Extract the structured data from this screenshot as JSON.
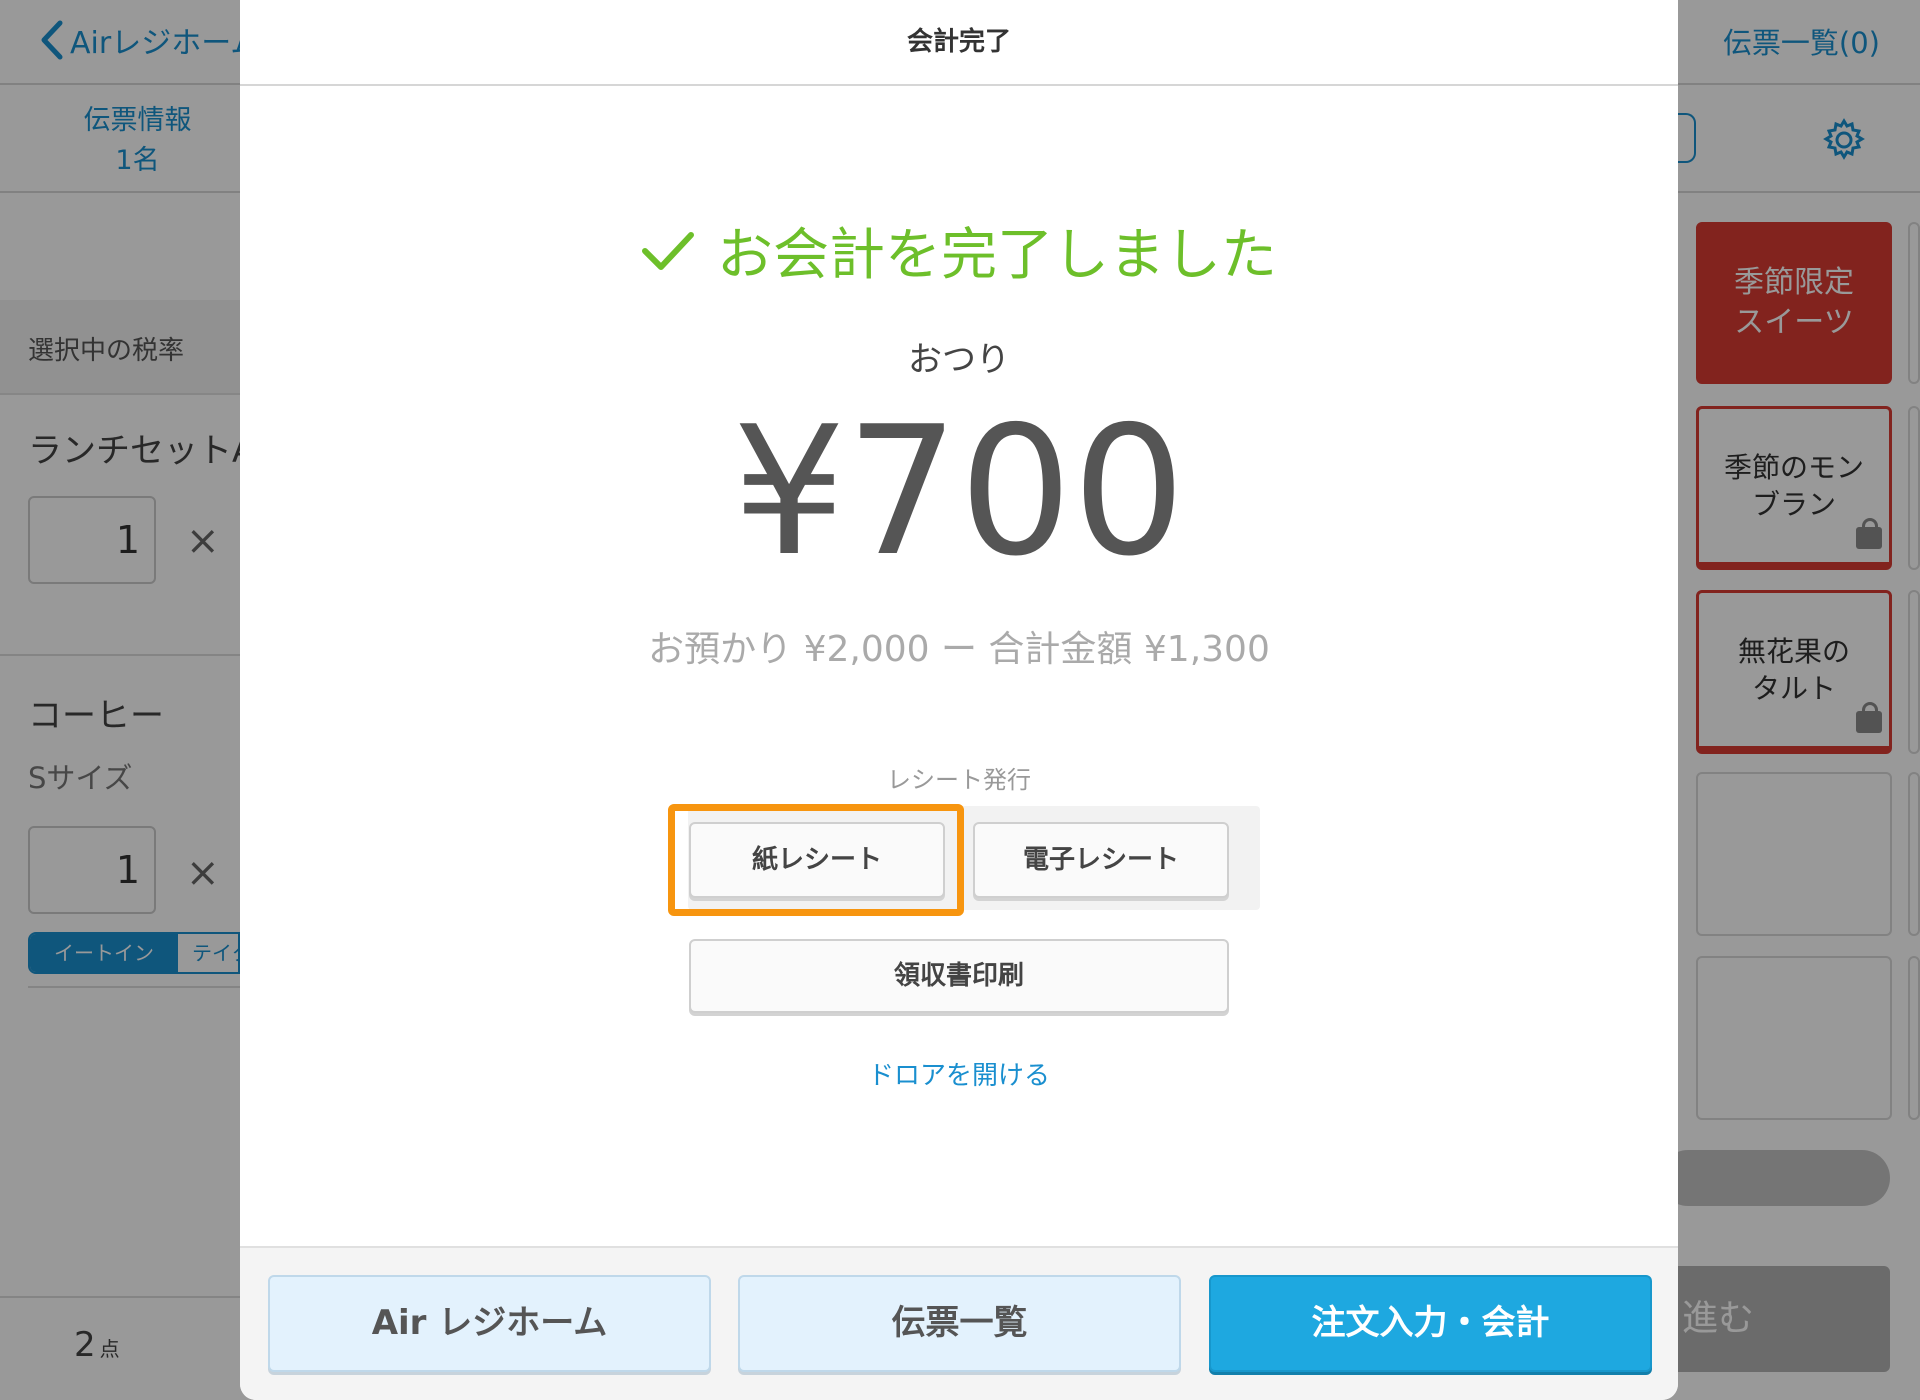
{
  "background_app": {
    "back_label": "Airレジホーム",
    "slip_list_label": "伝票一覧(0)",
    "slip_info_title": "伝票情報",
    "slip_info_people": "1名",
    "tax_rate_label": "選択中の税率",
    "items": [
      {
        "name": "ランチセットA",
        "qty": "1"
      },
      {
        "name": "コーヒー",
        "variant": "Sサイズ",
        "qty": "1"
      }
    ],
    "times_symbol": "×",
    "dine_segment": {
      "selected": "イートイン",
      "other": "テイクアウト"
    },
    "item_count": "2",
    "item_count_unit": "点",
    "category_tile": "季節限定\nスイーツ",
    "menu_tiles": [
      "季節のモン\nブラン",
      "無花果の\nタルト"
    ],
    "next_button": "進む"
  },
  "modal": {
    "title": "会計完了",
    "success_message": "お会計を完了しました",
    "change_label": "おつり",
    "change_amount": "¥700",
    "breakdown": "お預かり ¥2,000 ー 合計金額 ¥1,300",
    "receipt_section_label": "レシート発行",
    "paper_receipt_button": "紙レシート",
    "e_receipt_button": "電子レシート",
    "invoice_print_button": "領収書印刷",
    "open_drawer_link": "ドロアを開ける",
    "footer_buttons": {
      "home": "Air レジホーム",
      "slip_list": "伝票一覧",
      "order_entry": "注文入力・会計"
    }
  },
  "colors": {
    "accent_blue": "#1a8fcf",
    "primary_button": "#1ea8e0",
    "success_green": "#6dbf2a",
    "highlight_orange": "#f7950f",
    "category_red": "#d93b33"
  },
  "icons": [
    "chevron-left-icon",
    "gear-icon",
    "check-icon",
    "shopping-bag-icon"
  ]
}
